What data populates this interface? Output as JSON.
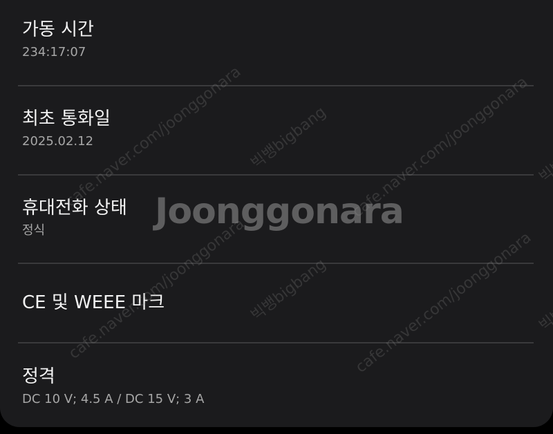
{
  "items": [
    {
      "title": "가동 시간",
      "sub": "234:17:07"
    },
    {
      "title": "최초 통화일",
      "sub": "2025.02.12"
    },
    {
      "title": "휴대전화 상태",
      "sub": "정식"
    },
    {
      "title": "CE 및 WEEE 마크",
      "sub": ""
    },
    {
      "title": "정격",
      "sub": "DC 10 V; 4.5 A / DC 15 V; 3 A"
    }
  ],
  "watermark": {
    "logo": "Joonggonara",
    "url": "cafe.naver.com/joonggonara",
    "handle": "빅뱅bigbang"
  },
  "colors": {
    "background": "#1b1b1d",
    "title": "#f3f3f3",
    "subtitle": "#a7a7a7",
    "divider": "#3a3a3c"
  }
}
